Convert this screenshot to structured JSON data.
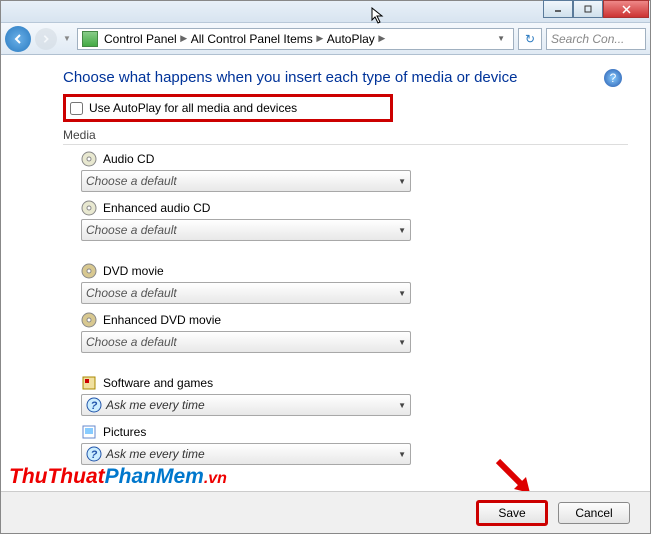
{
  "breadcrumb": {
    "items": [
      "Control Panel",
      "All Control Panel Items",
      "AutoPlay"
    ]
  },
  "search": {
    "placeholder": "Search Con..."
  },
  "heading": "Choose what happens when you insert each type of media or device",
  "checkbox": {
    "label": "Use AutoPlay for all media and devices",
    "checked": false
  },
  "section": {
    "title": "Media"
  },
  "items": [
    {
      "label": "Audio CD",
      "value": "Choose a default",
      "style": "default"
    },
    {
      "label": "Enhanced audio CD",
      "value": "Choose a default",
      "style": "default"
    },
    {
      "label": "DVD movie",
      "value": "Choose a default",
      "style": "default"
    },
    {
      "label": "Enhanced DVD movie",
      "value": "Choose a default",
      "style": "default"
    },
    {
      "label": "Software and games",
      "value": "Ask me every time",
      "style": "ask"
    },
    {
      "label": "Pictures",
      "value": "Ask me every time",
      "style": "ask"
    }
  ],
  "buttons": {
    "save": "Save",
    "cancel": "Cancel"
  },
  "watermark": {
    "part1": "ThuThuat",
    "part2": "PhanMem",
    "part3": ".vn"
  }
}
